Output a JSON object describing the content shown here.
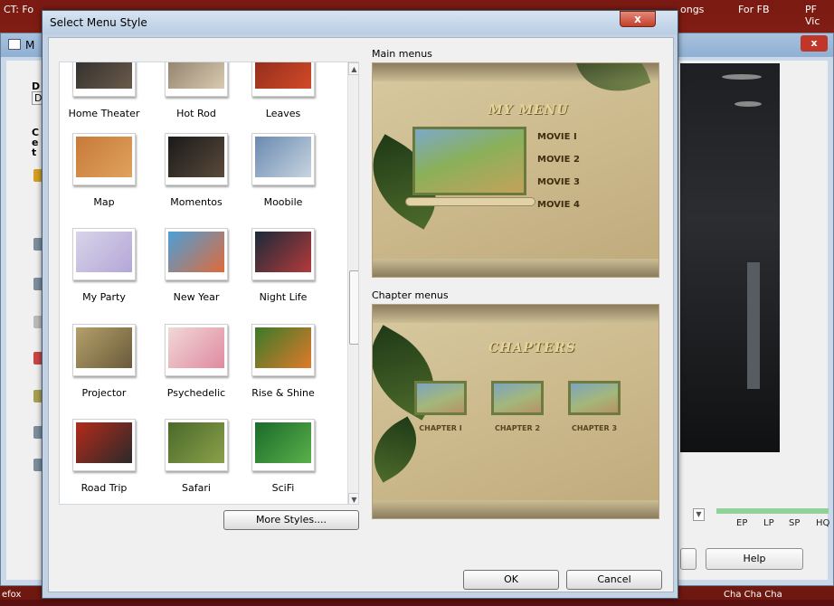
{
  "desktop": {
    "top_items": [
      "CT: Fo",
      "ongs",
      "For FB",
      "PF Vic"
    ],
    "bottom_left": "efox",
    "bottom_right": "Cha Cha Cha"
  },
  "bg_window": {
    "title": "M",
    "close": "x",
    "left_fragments": [
      "D",
      "DV",
      "C",
      "e",
      "t"
    ],
    "quality_labels": [
      "EP",
      "LP",
      "SP",
      "HQ"
    ],
    "help_label": "Help"
  },
  "dialog": {
    "title": "Select Menu Style",
    "close": "x",
    "styles": [
      {
        "label": "Home Theater",
        "colors": [
          "#2b2b2b",
          "#6b5a4a"
        ]
      },
      {
        "label": "Hot Rod",
        "colors": [
          "#8a7a66",
          "#d8c9b0"
        ]
      },
      {
        "label": "Leaves",
        "colors": [
          "#8a2a1a",
          "#d24a28"
        ]
      },
      {
        "label": "Map",
        "colors": [
          "#c87a3a",
          "#e0a25e"
        ]
      },
      {
        "label": "Momentos",
        "colors": [
          "#1a1a1a",
          "#5a4a3a"
        ]
      },
      {
        "label": "Moobile",
        "colors": [
          "#6a8ab0",
          "#c8d4e0"
        ]
      },
      {
        "label": "My Party",
        "colors": [
          "#d8d4e8",
          "#b4a6d8"
        ]
      },
      {
        "label": "New Year",
        "colors": [
          "#4aa0d8",
          "#e06a3a"
        ]
      },
      {
        "label": "Night Life",
        "colors": [
          "#1a2a3a",
          "#b43a3a"
        ]
      },
      {
        "label": "Projector",
        "colors": [
          "#b4a06a",
          "#6a5a3a"
        ]
      },
      {
        "label": "Psychedelic",
        "colors": [
          "#f0d8d8",
          "#e08aa0"
        ]
      },
      {
        "label": "Rise & Shine",
        "colors": [
          "#3a7a2a",
          "#e07a2a"
        ]
      },
      {
        "label": "Road Trip",
        "colors": [
          "#b42a1a",
          "#2a2a2a"
        ]
      },
      {
        "label": "Safari",
        "colors": [
          "#4a6a2a",
          "#8aa04a"
        ]
      },
      {
        "label": "SciFi",
        "colors": [
          "#1a6a2a",
          "#5ab04a"
        ]
      }
    ],
    "more_styles_label": "More Styles....",
    "main_menus_label": "Main menus",
    "chapter_menus_label": "Chapter menus",
    "main_preview": {
      "title": "MY MENU",
      "items": [
        "MOVIE I",
        "MOVIE 2",
        "MOVIE 3",
        "MOVIE 4"
      ]
    },
    "chapter_preview": {
      "title": "CHAPTERS",
      "chapters": [
        "CHAPTER I",
        "CHAPTER 2",
        "CHAPTER 3"
      ]
    },
    "ok_label": "OK",
    "cancel_label": "Cancel"
  }
}
